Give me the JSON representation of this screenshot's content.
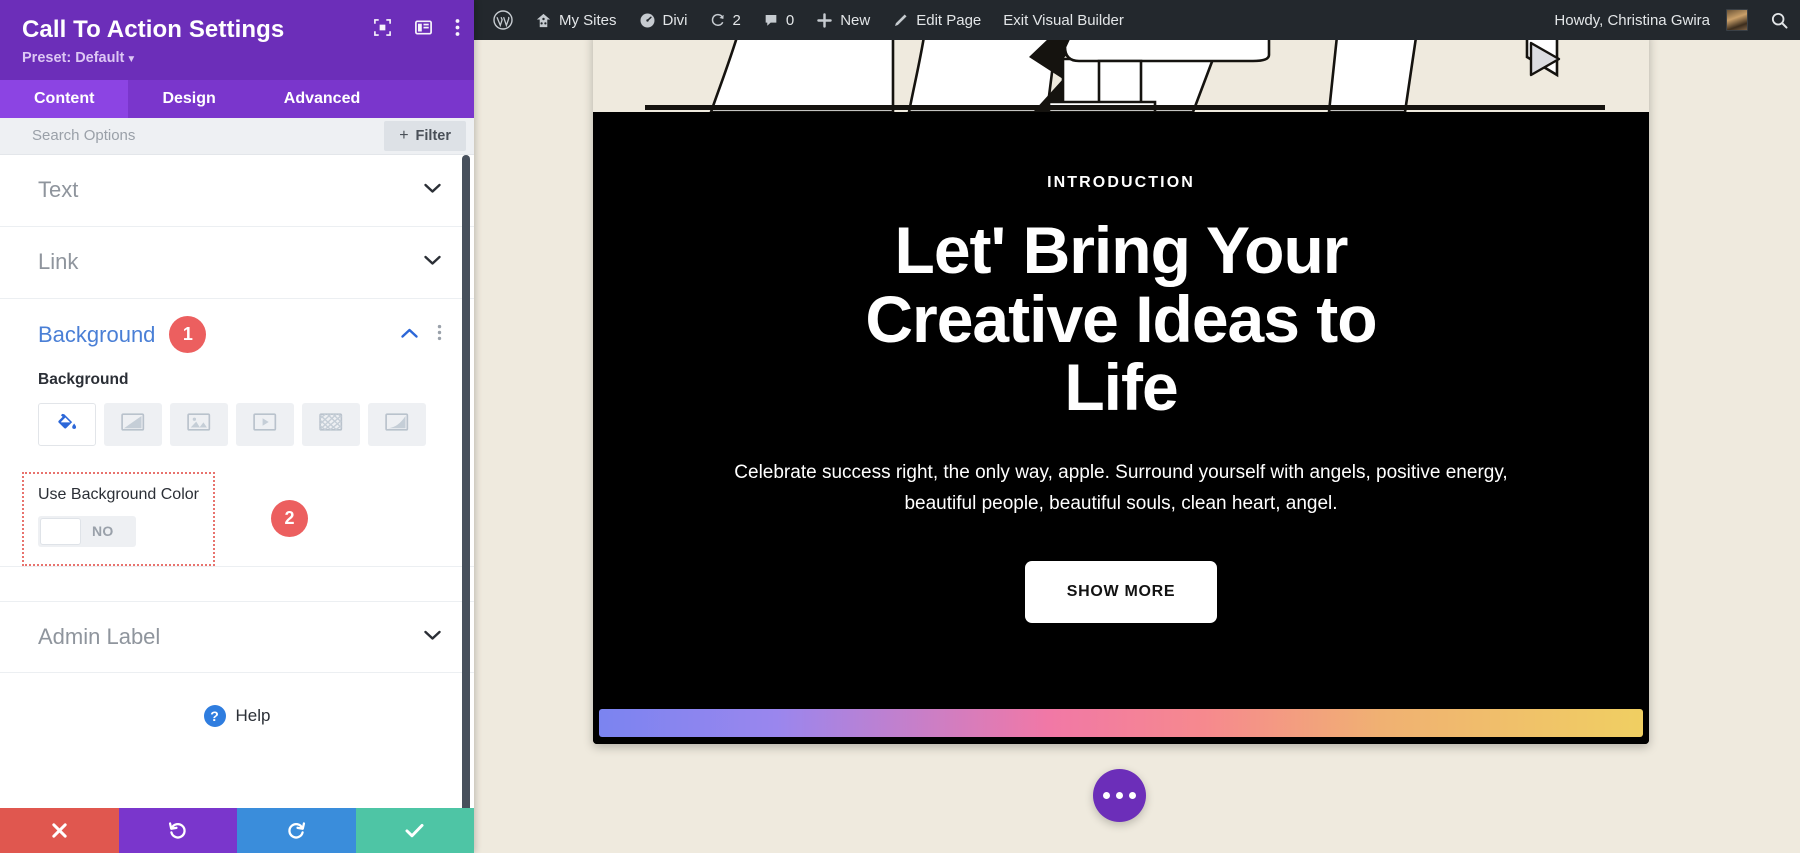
{
  "panel": {
    "title": "Call To Action Settings",
    "preset_label": "Preset: Default",
    "header_icons": [
      "focus-target-icon",
      "layout-panel-icon",
      "more-vertical-icon"
    ],
    "tabs": [
      {
        "label": "Content",
        "active": true
      },
      {
        "label": "Design",
        "active": false
      },
      {
        "label": "Advanced",
        "active": false
      }
    ],
    "search": {
      "placeholder": "Search Options",
      "value": ""
    },
    "filter_button": {
      "label": "Filter",
      "plus": "+"
    },
    "sections": [
      {
        "label": "Text",
        "state": "collapsed"
      },
      {
        "label": "Link",
        "state": "collapsed"
      }
    ],
    "background_section": {
      "label": "Background",
      "state": "expanded",
      "badge": "1",
      "field_label": "Background",
      "types": [
        {
          "name": "background-color",
          "icon": "paint-bucket-icon",
          "active": true
        },
        {
          "name": "background-gradient",
          "icon": "gradient-icon",
          "active": false
        },
        {
          "name": "background-image",
          "icon": "image-icon",
          "active": false
        },
        {
          "name": "background-video",
          "icon": "video-icon",
          "active": false
        },
        {
          "name": "background-pattern",
          "icon": "pattern-icon",
          "active": false
        },
        {
          "name": "background-mask",
          "icon": "mask-icon",
          "active": false
        }
      ],
      "toggle": {
        "label": "Use Background Color",
        "value": "NO",
        "badge": "2",
        "highlight_color": "#e8736e"
      }
    },
    "admin_label_section": {
      "label": "Admin Label",
      "state": "collapsed"
    },
    "help": {
      "label": "Help",
      "icon": "question-mark-icon"
    },
    "footer": [
      {
        "name": "cancel-button",
        "icon": "close-icon",
        "color": "#e0574f"
      },
      {
        "name": "undo-button",
        "icon": "undo-icon",
        "color": "#7a36cc"
      },
      {
        "name": "redo-button",
        "icon": "redo-icon",
        "color": "#3a8ddb"
      },
      {
        "name": "save-button",
        "icon": "check-icon",
        "color": "#4ec5a5"
      }
    ]
  },
  "adminbar": {
    "items": [
      {
        "label": "",
        "icon": "wordpress-logo-icon"
      },
      {
        "label": "My Sites",
        "icon": "sites-icon"
      },
      {
        "label": "Divi",
        "icon": "divi-dashboard-icon"
      },
      {
        "label": "2",
        "icon": "updates-icon"
      },
      {
        "label": "0",
        "icon": "comments-icon"
      },
      {
        "label": "New",
        "icon": "plus-icon"
      },
      {
        "label": "Edit Page",
        "icon": "pencil-icon"
      },
      {
        "label": "Exit Visual Builder",
        "icon": ""
      }
    ],
    "howdy": "Howdy, Christina Gwira",
    "avatar": "user-avatar",
    "search_icon": "search-icon"
  },
  "cta": {
    "eyebrow": "INTRODUCTION",
    "heading": "Let' Bring Your Creative Ideas to Life",
    "body": "Celebrate success right, the only way, apple. Surround yourself with angels, positive energy, beautiful people, beautiful souls, clean heart, angel.",
    "button_label": "SHOW MORE",
    "background_color": "#000000",
    "gradient_bar_colors": [
      "#7b84f0",
      "#f178a6",
      "#f0cf62"
    ]
  },
  "fab": {
    "name": "page-settings-button",
    "icon": "ellipsis-icon"
  },
  "colors": {
    "panel_header": "#6c2eb9",
    "tabs_bar": "#7a36cc",
    "active_tab": "#8c44e3",
    "canvas_bg": "#efeade",
    "adminbar_bg": "#23282d",
    "badge": "#ec5f5f",
    "accent_blue": "#4a7fd6"
  }
}
